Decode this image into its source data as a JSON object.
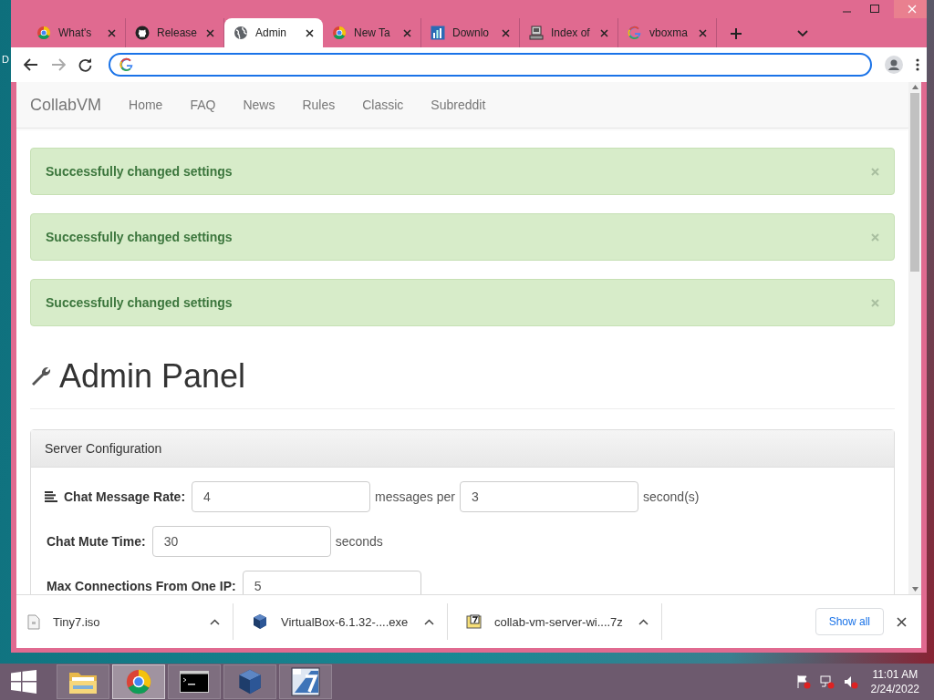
{
  "desktop": {
    "icon_label": "D"
  },
  "tabs": [
    {
      "title": "What's",
      "kind": "chrome",
      "selected": false
    },
    {
      "title": "Release",
      "kind": "github",
      "selected": false
    },
    {
      "title": "Admin",
      "kind": "globe",
      "selected": true
    },
    {
      "title": "New Ta",
      "kind": "chrome",
      "selected": false
    },
    {
      "title": "Downlo",
      "kind": "chart",
      "selected": false
    },
    {
      "title": "Index of",
      "kind": "server",
      "selected": false
    },
    {
      "title": "vboxma",
      "kind": "google",
      "selected": false
    }
  ],
  "site": {
    "brand": "CollabVM",
    "nav": [
      "Home",
      "FAQ",
      "News",
      "Rules",
      "Classic",
      "Subreddit"
    ]
  },
  "alerts": [
    {
      "text": "Successfully changed settings"
    },
    {
      "text": "Successfully changed settings"
    },
    {
      "text": "Successfully changed settings"
    }
  ],
  "heading": "Admin Panel",
  "panel": {
    "title": "Server Configuration",
    "rows": [
      {
        "label": "Chat Message Rate:",
        "kind": "lines",
        "items": [
          {
            "kind": "field",
            "value": "4"
          },
          {
            "kind": "text",
            "text": "messages per"
          },
          {
            "kind": "field",
            "value": "3"
          },
          {
            "kind": "text",
            "text": "second(s)"
          }
        ]
      },
      {
        "label": "Chat Mute Time:",
        "kind": "plain",
        "items": [
          {
            "kind": "field",
            "value": "30"
          },
          {
            "kind": "text",
            "text": "seconds"
          }
        ]
      },
      {
        "label": "Max Connections From One IP:",
        "kind": "plain",
        "items": [
          {
            "kind": "field",
            "value": "5"
          }
        ]
      }
    ]
  },
  "downloads": [
    {
      "name": "Tiny7.iso",
      "kind": "file"
    },
    {
      "name": "VirtualBox-6.1.32-....exe",
      "kind": "cube"
    },
    {
      "name": "collab-vm-server-wi....7z",
      "kind": "archive"
    }
  ],
  "show_all": "Show all",
  "taskbar": {
    "apps": [
      {
        "kind": "folder",
        "selected": false
      },
      {
        "kind": "chrome",
        "selected": true
      },
      {
        "kind": "terminal",
        "selected": false
      },
      {
        "kind": "cube",
        "selected": false
      },
      {
        "kind": "sevenzip",
        "selected": false
      }
    ],
    "time": "11:01 AM",
    "date": "2/24/2022"
  }
}
